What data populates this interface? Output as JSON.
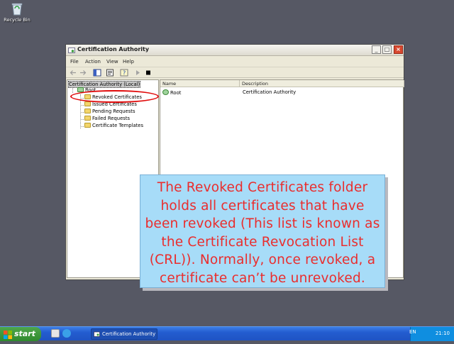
{
  "desktop": {
    "recycle_bin_label": "Recycle Bin"
  },
  "window": {
    "title": "Certification Authority",
    "menu": [
      "File",
      "Action",
      "View",
      "Help"
    ],
    "tree": {
      "root": "Certification Authority (Local)",
      "ca": "Root",
      "folders": [
        "Revoked Certificates",
        "Issued Certificates",
        "Pending Requests",
        "Failed Requests",
        "Certificate Templates"
      ]
    },
    "list": {
      "columns": [
        "Name",
        "Description"
      ],
      "rows": [
        {
          "name": "Root",
          "description": "Certification Authority"
        }
      ]
    }
  },
  "annotation": {
    "text": "The Revoked Certificates folder holds all certificates that have been revoked (This list is known as the Certificate Revocation List (CRL)). Normally, once revoked, a certificate can’t be unrevoked.",
    "text_color": "#ea2d2d",
    "background": "#a7dcf8",
    "highlight_color": "#e00b0b"
  },
  "taskbar": {
    "start_label": "start",
    "task_button": "Certification Authority",
    "language": "EN",
    "clock": "21:10"
  }
}
